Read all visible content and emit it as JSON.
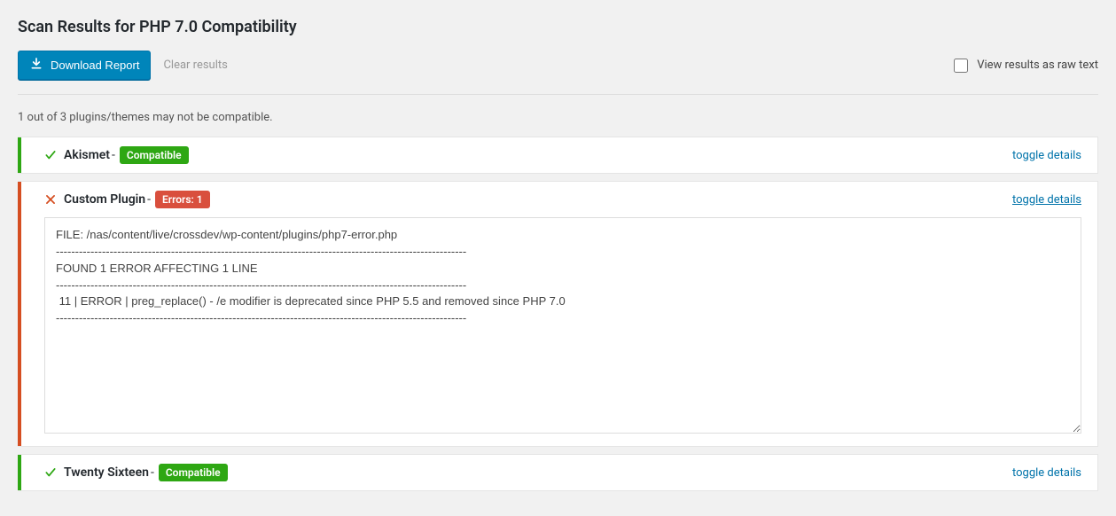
{
  "pageTitle": "Scan Results for PHP 7.0 Compatibility",
  "toolbar": {
    "downloadLabel": "Download Report",
    "clearLabel": "Clear results",
    "rawTextLabel": "View results as raw text"
  },
  "summary": "1 out of 3 plugins/themes may not be compatible.",
  "toggleDetailsLabel": "toggle details",
  "results": [
    {
      "name": "Akismet",
      "status": "ok",
      "badge": "Compatible",
      "badgeClass": "compatible",
      "expanded": false
    },
    {
      "name": "Custom Plugin",
      "status": "error",
      "badge": "Errors: 1",
      "badgeClass": "errors",
      "expanded": true,
      "details": "FILE: /nas/content/live/crossdev/wp-content/plugins/php7-error.php\n-----------------------------------------------------------------------------------------------------------\nFOUND 1 ERROR AFFECTING 1 LINE\n-----------------------------------------------------------------------------------------------------------\n 11 | ERROR | preg_replace() - /e modifier is deprecated since PHP 5.5 and removed since PHP 7.0\n-----------------------------------------------------------------------------------------------------------"
    },
    {
      "name": "Twenty Sixteen",
      "status": "ok",
      "badge": "Compatible",
      "badgeClass": "compatible",
      "expanded": false
    }
  ]
}
